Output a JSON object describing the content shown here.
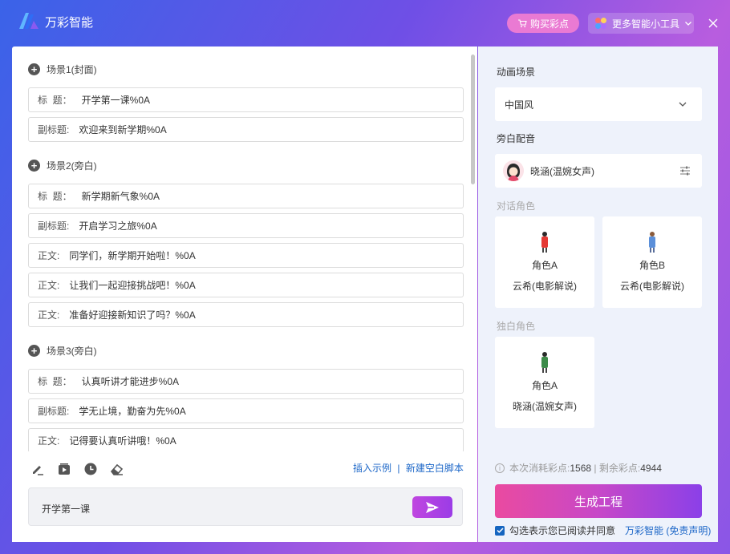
{
  "header": {
    "app_name": "万彩智能",
    "buy_label": "购买彩点",
    "tools_label": "更多智能小工具"
  },
  "scenes": [
    {
      "title": "场景1(封面)",
      "fields": [
        {
          "label": "标  题：",
          "value": "开学第一课%0A"
        },
        {
          "label": "副标题:",
          "value": "欢迎来到新学期%0A"
        }
      ]
    },
    {
      "title": "场景2(旁白)",
      "fields": [
        {
          "label": "标  题：",
          "value": "新学期新气象%0A"
        },
        {
          "label": "副标题:",
          "value": "开启学习之旅%0A"
        },
        {
          "label": "正文:",
          "value": "同学们，新学期开始啦！%0A"
        },
        {
          "label": "正文:",
          "value": "让我们一起迎接挑战吧！%0A"
        },
        {
          "label": "正文:",
          "value": "准备好迎接新知识了吗？%0A"
        }
      ]
    },
    {
      "title": "场景3(旁白)",
      "fields": [
        {
          "label": "标  题：",
          "value": "认真听讲才能进步%0A"
        },
        {
          "label": "副标题:",
          "value": "学无止境，勤奋为先%0A"
        },
        {
          "label": "正文:",
          "value": "记得要认真听讲哦！%0A"
        }
      ]
    }
  ],
  "toolbar": {
    "icons": [
      "edit-icon",
      "media-icon",
      "clock-icon",
      "eraser-icon"
    ],
    "insert_example": "插入示例",
    "separator": "|",
    "new_blank_script": "新建空白脚本"
  },
  "prompt": {
    "value": "开学第一课"
  },
  "right": {
    "animation_scene_title": "动画场景",
    "animation_scene_value": "中国风",
    "narration_title": "旁白配音",
    "narration_voice": "晓涵(温婉女声)",
    "dialogue_title": "对话角色",
    "dialogue_roles": [
      {
        "name": "角色A",
        "voice": "云希(电影解说)",
        "color": "#e53935"
      },
      {
        "name": "角色B",
        "voice": "云希(电影解说)",
        "color": "#5b8fd9"
      }
    ],
    "solo_title": "独白角色",
    "solo_roles": [
      {
        "name": "角色A",
        "voice": "晓涵(温婉女声)",
        "color": "#3d8b4a"
      }
    ],
    "cost_label": "本次消耗彩点:",
    "cost_value": "1568",
    "remain_label": "剩余彩点:",
    "remain_value": "4944",
    "cost_separator": "|",
    "generate_label": "生成工程",
    "agree_text": "勾选表示您已阅读并同意",
    "agree_link": "万彩智能 (免责声明)"
  },
  "colors": {
    "accent_link": "#1d67c8",
    "generate_start": "#ea4aa0",
    "generate_end": "#8b40e8"
  }
}
